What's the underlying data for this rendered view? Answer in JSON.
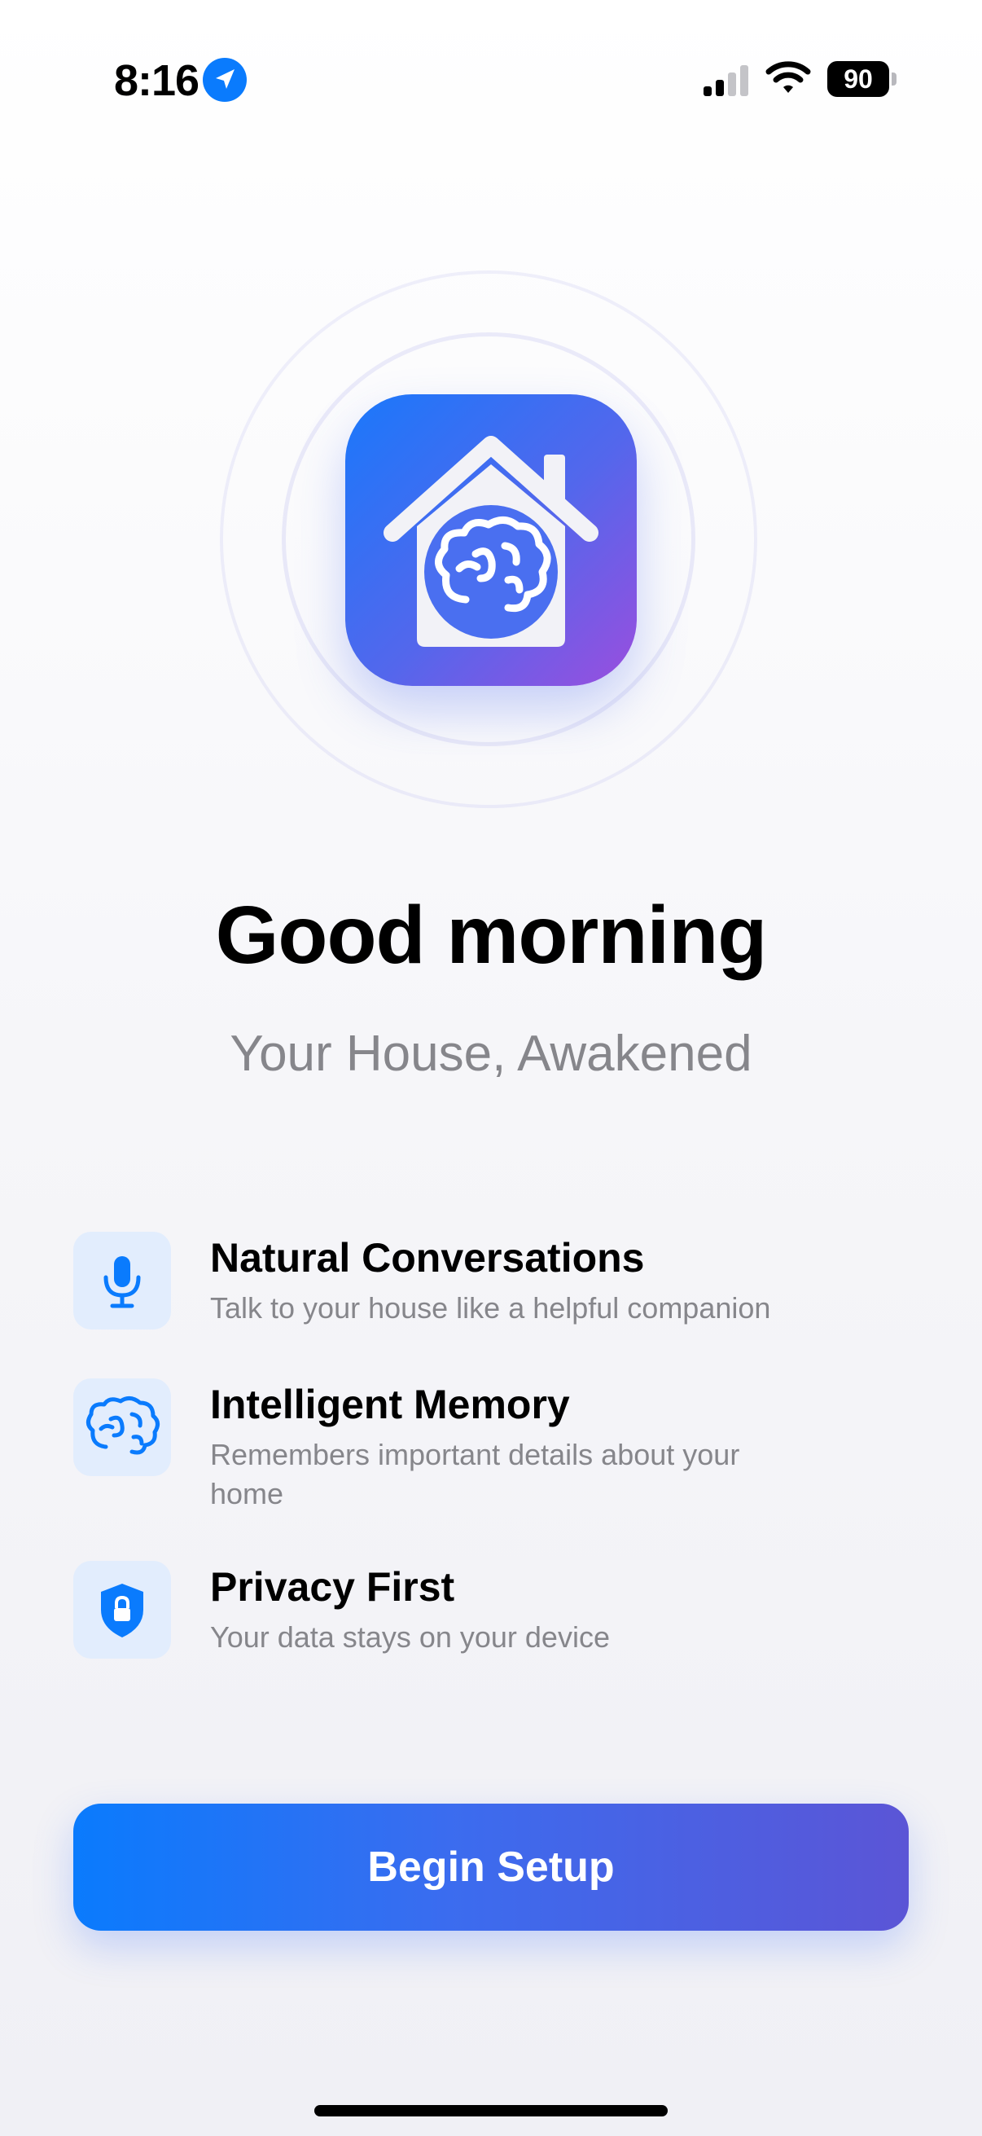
{
  "status_bar": {
    "time": "8:16",
    "battery_level": "90",
    "icons": [
      "location-arrow-icon",
      "cellular-signal-icon",
      "wifi-icon",
      "battery-icon"
    ]
  },
  "hero": {
    "app_icon": "house-brain-icon",
    "greeting": "Good morning",
    "subtitle": "Your House, Awakened"
  },
  "features": [
    {
      "icon": "microphone-icon",
      "title": "Natural Conversations",
      "description": "Talk to your house like a helpful companion"
    },
    {
      "icon": "brain-icon",
      "title": "Intelligent Memory",
      "description": "Remembers important details about your home"
    },
    {
      "icon": "lock-shield-icon",
      "title": "Privacy First",
      "description": "Your data stays on your device"
    }
  ],
  "cta": {
    "label": "Begin Setup"
  },
  "colors": {
    "accent_start": "#0a7bfd",
    "accent_end": "#5b55d6",
    "icon_gradient_end": "#9a4ede",
    "feature_icon_bg": "#e2edfd",
    "secondary_text": "#86868b"
  }
}
